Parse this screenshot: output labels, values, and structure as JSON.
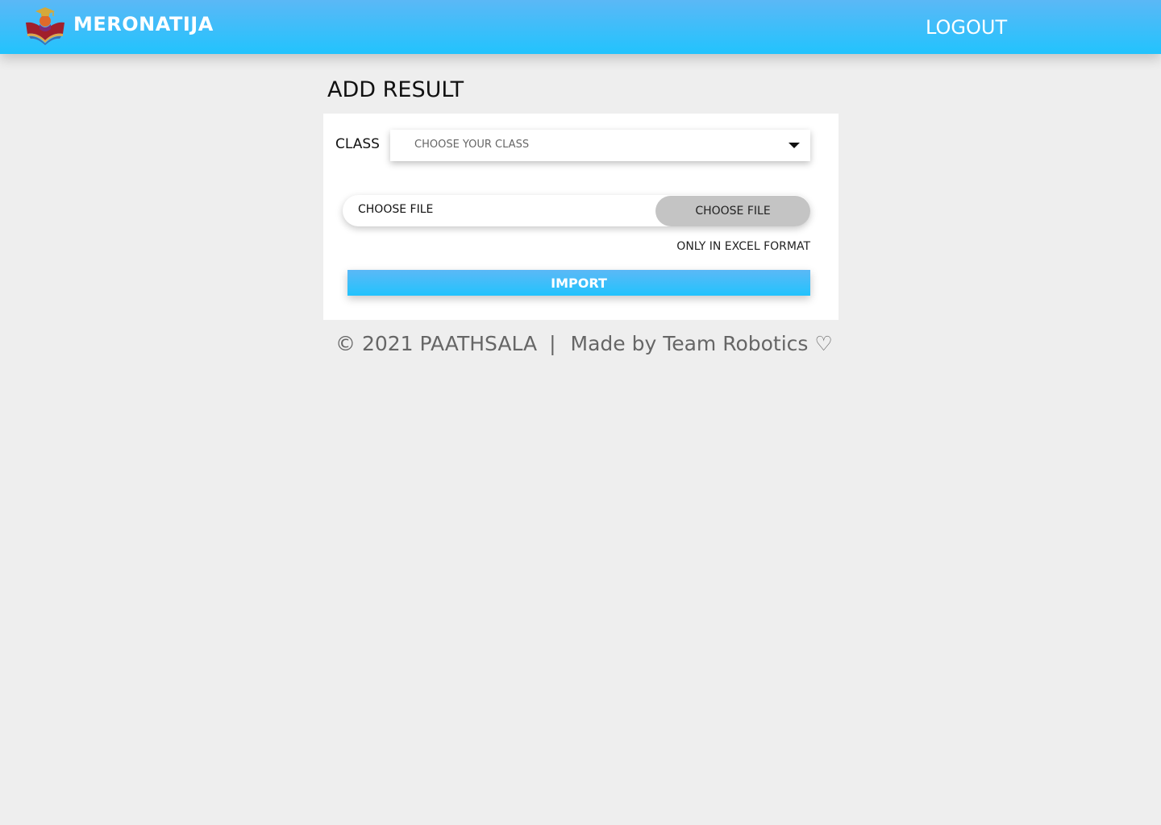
{
  "header": {
    "brand_name": "MERONATIJA",
    "logout_label": "LOGOUT",
    "logo_icon": "graduation-book-logo",
    "colors": {
      "gradient_top": "#5bb8f6",
      "gradient_bottom": "#22c3fd"
    }
  },
  "page": {
    "title": "ADD RESULT"
  },
  "form": {
    "class_label": "CLASS",
    "class_select_value": "CHOOSE YOUR CLASS",
    "file_name_text": "CHOOSE FILE",
    "file_button_label": "CHOOSE FILE",
    "format_note": "ONLY IN EXCEL FORMAT",
    "import_label": "IMPORT"
  },
  "footer": {
    "copyright": "© 2021 PAATHSALA",
    "separator": "|",
    "credit": "Made by Team Robotics ♡"
  }
}
